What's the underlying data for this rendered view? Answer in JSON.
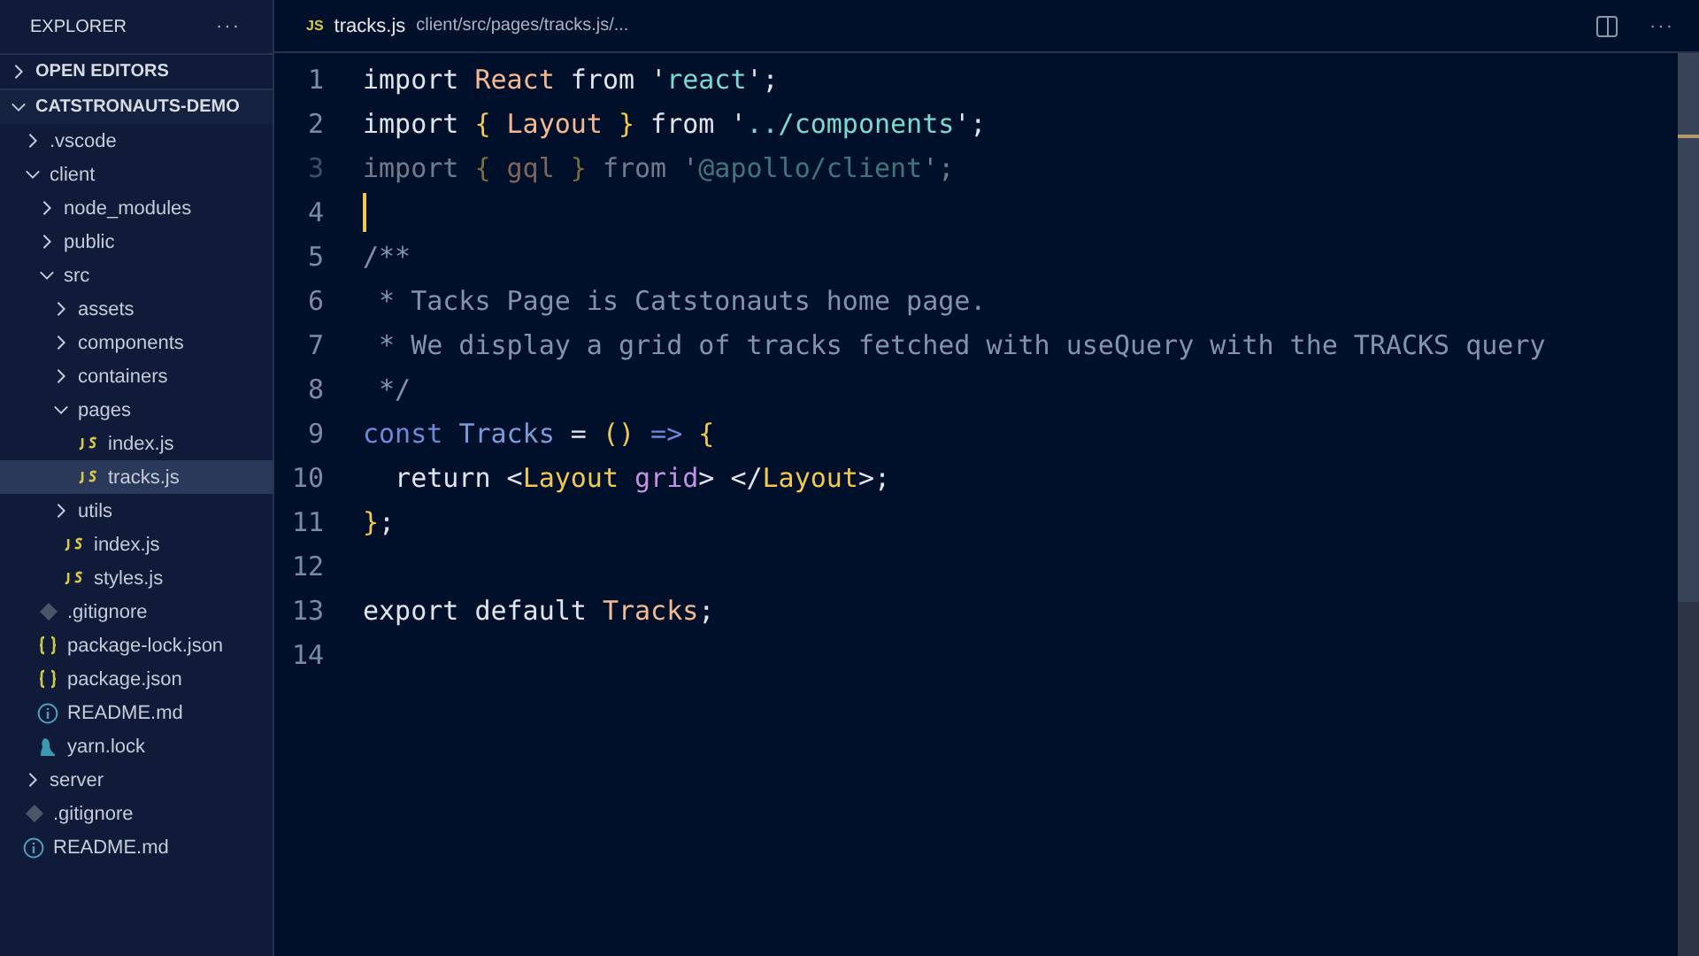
{
  "sidebar": {
    "title": "EXPLORER",
    "more": "···",
    "sections": [
      {
        "label": "OPEN EDITORS",
        "expanded": false
      },
      {
        "label": "CATSTRONAUTS-DEMO",
        "expanded": true
      }
    ],
    "tree": [
      {
        "name": ".vscode",
        "kind": "folder",
        "expanded": false,
        "selected": false
      },
      {
        "name": "client",
        "kind": "folder",
        "expanded": true,
        "selected": false,
        "children": [
          {
            "name": "node_modules",
            "kind": "folder",
            "expanded": false,
            "selected": false
          },
          {
            "name": "public",
            "kind": "folder",
            "expanded": false,
            "selected": false
          },
          {
            "name": "src",
            "kind": "folder",
            "expanded": true,
            "selected": false,
            "children": [
              {
                "name": "assets",
                "kind": "folder",
                "expanded": false,
                "selected": false
              },
              {
                "name": "components",
                "kind": "folder",
                "expanded": false,
                "selected": false
              },
              {
                "name": "containers",
                "kind": "folder",
                "expanded": false,
                "selected": false
              },
              {
                "name": "pages",
                "kind": "folder",
                "expanded": true,
                "selected": false,
                "children": [
                  {
                    "name": "index.js",
                    "kind": "js",
                    "selected": false
                  },
                  {
                    "name": "tracks.js",
                    "kind": "js",
                    "selected": true
                  }
                ]
              },
              {
                "name": "utils",
                "kind": "folder",
                "expanded": false,
                "selected": false
              },
              {
                "name": "index.js",
                "kind": "js",
                "selected": false
              },
              {
                "name": "styles.js",
                "kind": "js",
                "selected": false
              }
            ]
          },
          {
            "name": ".gitignore",
            "kind": "git",
            "selected": false
          },
          {
            "name": "package-lock.json",
            "kind": "json",
            "selected": false
          },
          {
            "name": "package.json",
            "kind": "json",
            "selected": false
          },
          {
            "name": "README.md",
            "kind": "info",
            "selected": false
          },
          {
            "name": "yarn.lock",
            "kind": "yarn",
            "selected": false
          }
        ]
      },
      {
        "name": "server",
        "kind": "folder",
        "expanded": false,
        "selected": false
      },
      {
        "name": ".gitignore",
        "kind": "git",
        "selected": false
      },
      {
        "name": "README.md",
        "kind": "info",
        "selected": false
      }
    ]
  },
  "editor": {
    "tab": {
      "badge": "JS",
      "name": "tracks.js",
      "path": "client/src/pages/tracks.js/..."
    },
    "more": "···",
    "lines": [
      {
        "number": "1",
        "faded": false,
        "cursor": false,
        "tokens": [
          {
            "kind": "kw",
            "text": "import "
          },
          {
            "kind": "ident",
            "text": "React"
          },
          {
            "kind": "kw",
            "text": " from "
          },
          {
            "kind": "punct",
            "text": "'"
          },
          {
            "kind": "str",
            "text": "react"
          },
          {
            "kind": "punct",
            "text": "';"
          }
        ]
      },
      {
        "number": "2",
        "faded": false,
        "cursor": false,
        "tokens": [
          {
            "kind": "kw",
            "text": "import "
          },
          {
            "kind": "brace",
            "text": "{"
          },
          {
            "kind": "ident",
            "text": " Layout "
          },
          {
            "kind": "brace",
            "text": "}"
          },
          {
            "kind": "kw",
            "text": " from "
          },
          {
            "kind": "punct",
            "text": "'"
          },
          {
            "kind": "str",
            "text": "../components"
          },
          {
            "kind": "punct",
            "text": "';"
          }
        ]
      },
      {
        "number": "3",
        "faded": true,
        "cursor": false,
        "tokens": [
          {
            "kind": "kw",
            "text": "import "
          },
          {
            "kind": "brace",
            "text": "{"
          },
          {
            "kind": "ident",
            "text": " gql "
          },
          {
            "kind": "brace",
            "text": "}"
          },
          {
            "kind": "kw",
            "text": " from "
          },
          {
            "kind": "punct",
            "text": "'"
          },
          {
            "kind": "str",
            "text": "@apollo/client"
          },
          {
            "kind": "punct",
            "text": "';"
          }
        ]
      },
      {
        "number": "4",
        "faded": false,
        "cursor": true
      },
      {
        "number": "5",
        "faded": false,
        "cursor": false,
        "tokens": [
          {
            "kind": "comment",
            "text": "/**"
          }
        ]
      },
      {
        "number": "6",
        "faded": false,
        "cursor": false,
        "tokens": [
          {
            "kind": "comment",
            "text": " * Tacks Page is Catstonauts home page."
          }
        ]
      },
      {
        "number": "7",
        "faded": false,
        "cursor": false,
        "tokens": [
          {
            "kind": "comment",
            "text": " * We display a grid of tracks fetched with useQuery with the TRACKS query"
          }
        ]
      },
      {
        "number": "8",
        "faded": false,
        "cursor": false,
        "tokens": [
          {
            "kind": "comment",
            "text": " */"
          }
        ]
      },
      {
        "number": "9",
        "faded": false,
        "cursor": false,
        "tokens": [
          {
            "kind": "storage",
            "text": "const "
          },
          {
            "kind": "fn",
            "text": "Tracks"
          },
          {
            "kind": "punct",
            "text": " = "
          },
          {
            "kind": "brace",
            "text": "()"
          },
          {
            "kind": "storage",
            "text": " => "
          },
          {
            "kind": "brace",
            "text": "{"
          }
        ]
      },
      {
        "number": "10",
        "faded": false,
        "cursor": false,
        "tokens": [
          {
            "kind": "kw",
            "text": "  return "
          },
          {
            "kind": "punct",
            "text": "<"
          },
          {
            "kind": "tag",
            "text": "Layout"
          },
          {
            "kind": "attr",
            "text": " grid"
          },
          {
            "kind": "punct",
            "text": "> </"
          },
          {
            "kind": "tag",
            "text": "Layout"
          },
          {
            "kind": "punct",
            "text": ">;"
          }
        ]
      },
      {
        "number": "11",
        "faded": false,
        "cursor": false,
        "tokens": [
          {
            "kind": "brace",
            "text": "}"
          },
          {
            "kind": "punct",
            "text": ";"
          }
        ]
      },
      {
        "number": "12",
        "faded": false,
        "cursor": false
      },
      {
        "number": "13",
        "faded": false,
        "cursor": false,
        "tokens": [
          {
            "kind": "kw",
            "text": "export default "
          },
          {
            "kind": "ident",
            "text": "Tracks"
          },
          {
            "kind": "punct",
            "text": ";"
          }
        ]
      },
      {
        "number": "14",
        "faded": false,
        "cursor": false
      }
    ]
  }
}
